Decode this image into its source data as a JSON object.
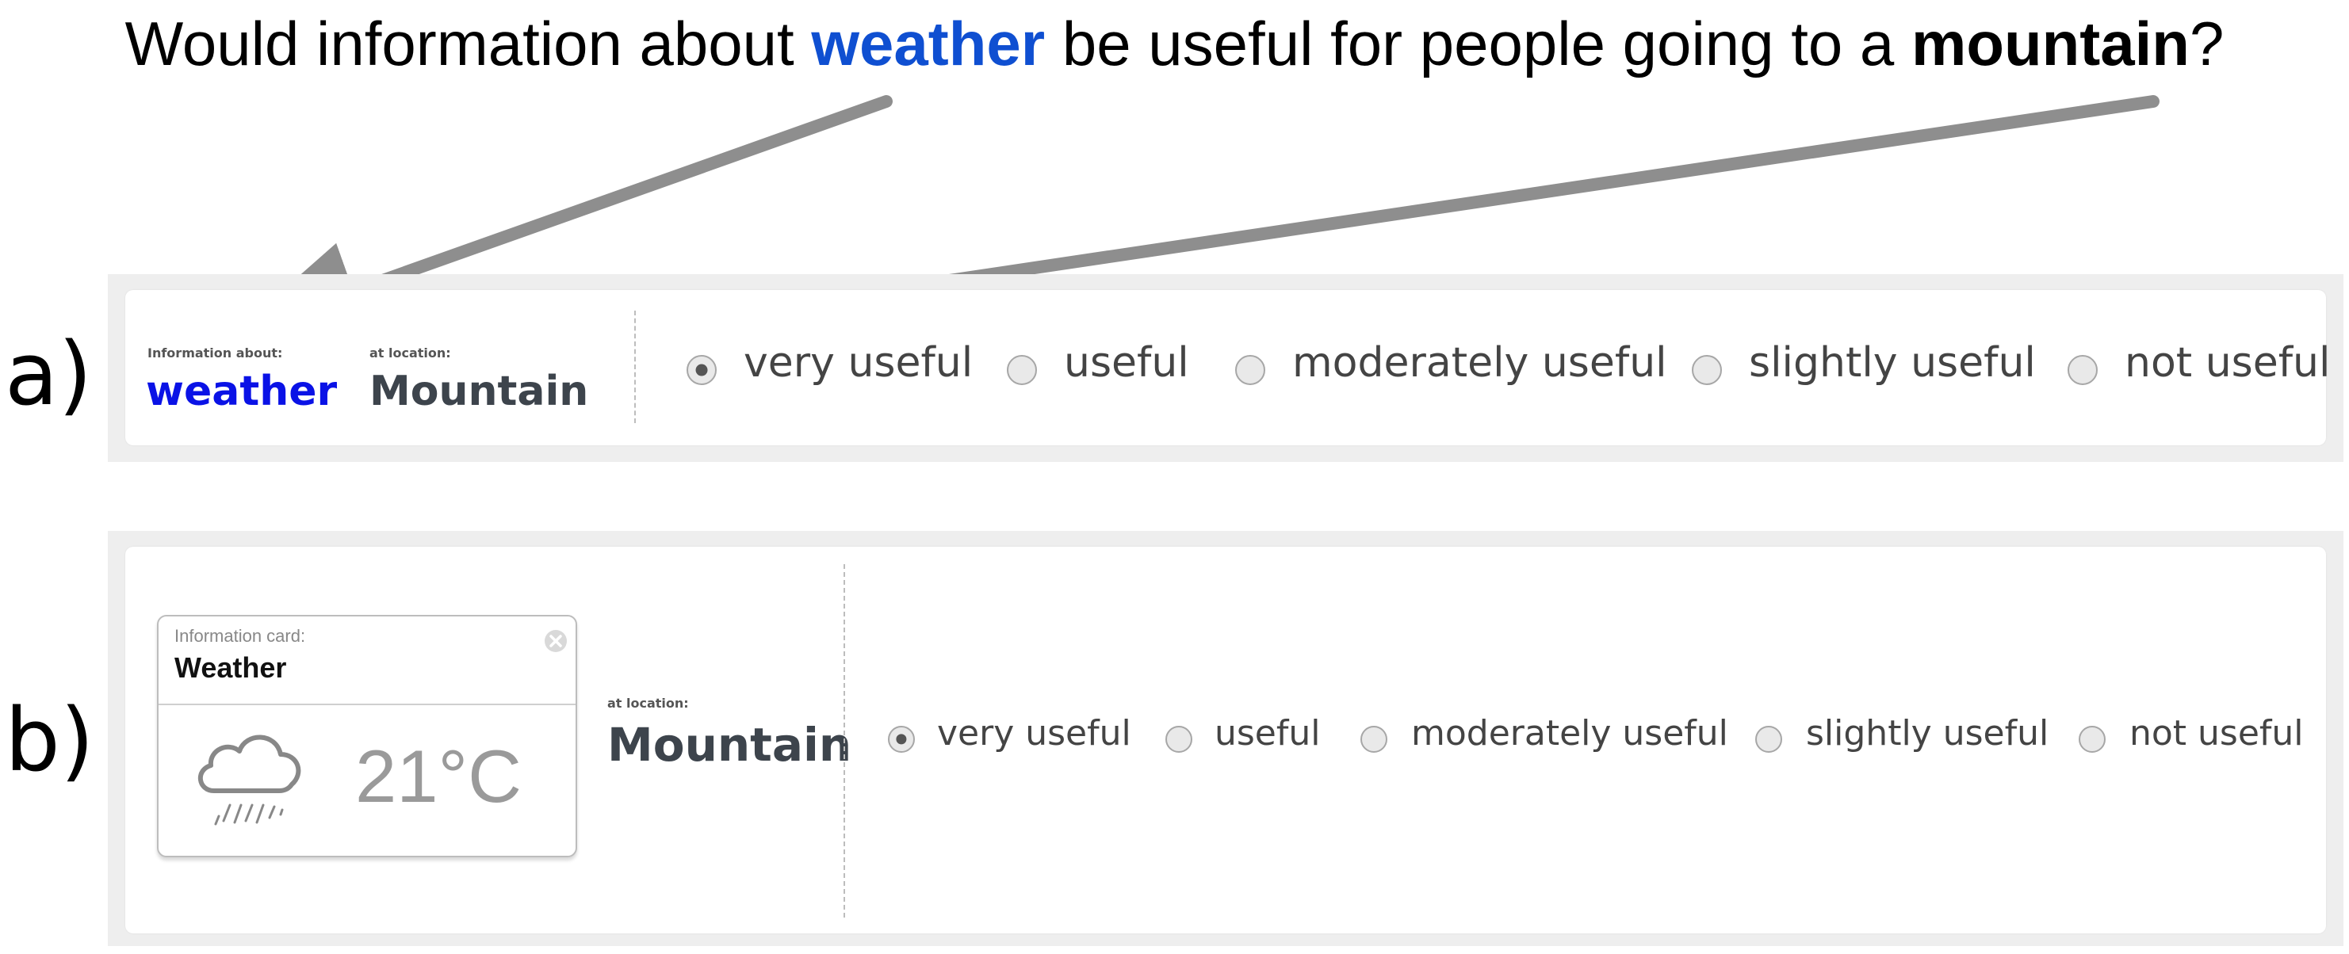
{
  "question": {
    "part1": "Would information about ",
    "keyword_topic": "weather",
    "part2": " be useful for people going to a ",
    "keyword_location": "mountain",
    "part3": "?"
  },
  "panel_a": {
    "label": "a)",
    "info_caption": "Information about:",
    "info_value": "weather",
    "location_caption": "at location:",
    "location_value": "Mountain",
    "options": [
      {
        "label": "very useful",
        "checked": true
      },
      {
        "label": "useful",
        "checked": false
      },
      {
        "label": "moderately useful",
        "checked": false
      },
      {
        "label": "slightly useful",
        "checked": false
      },
      {
        "label": "not useful",
        "checked": false
      }
    ]
  },
  "panel_b": {
    "label": "b)",
    "card_caption": "Information card:",
    "card_title": "Weather",
    "card_icon": "rain-cloud-icon",
    "card_temperature": "21°C",
    "location_caption": "at location:",
    "location_value": "Mountain",
    "options": [
      {
        "label": "very useful",
        "checked": true
      },
      {
        "label": "useful",
        "checked": false
      },
      {
        "label": "moderately useful",
        "checked": false
      },
      {
        "label": "slightly useful",
        "checked": false
      },
      {
        "label": "not useful",
        "checked": false
      }
    ]
  },
  "colors": {
    "topic_highlight": "#0f4fd1",
    "weather_value": "#0a12e6",
    "location_value": "#3d444c",
    "arrow": "#8e8e8e"
  }
}
